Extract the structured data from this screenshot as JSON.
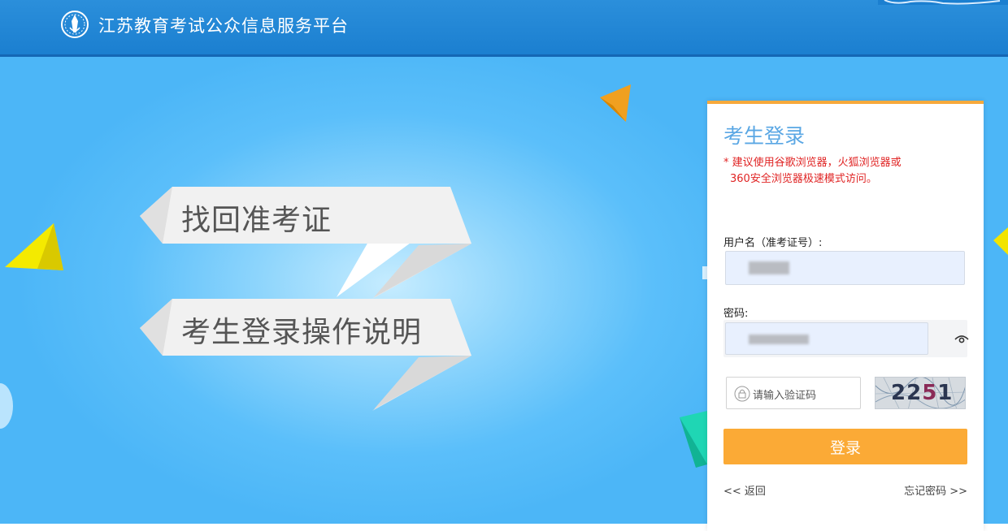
{
  "header": {
    "site_title": "江苏教育考试公众信息服务平台",
    "logo_icon": "emblem-icon",
    "colors": {
      "bar": "#1b7fd0",
      "border": "#1467b5"
    }
  },
  "links": {
    "retrieve_admission_ticket": "找回准考证",
    "login_instructions": "考生登录操作说明"
  },
  "login": {
    "title": "考生登录",
    "note_line1": "* 建议使用谷歌浏览器，火狐浏览器或",
    "note_line2": "360安全浏览器极速模式访问。",
    "username_label": "用户名（准考证号）:",
    "password_label": "密码:",
    "captcha_placeholder": "请输入验证码",
    "captcha_code_a": "22",
    "captcha_code_b": "5",
    "captcha_code_c": "1",
    "submit_label": "登录",
    "back_label": "<< 返回",
    "forgot_label": "忘记密码 >>",
    "colors": {
      "accent": "#f7a93b",
      "title": "#5aa7e4",
      "note": "#e02424",
      "button": "#fbaa36"
    }
  }
}
